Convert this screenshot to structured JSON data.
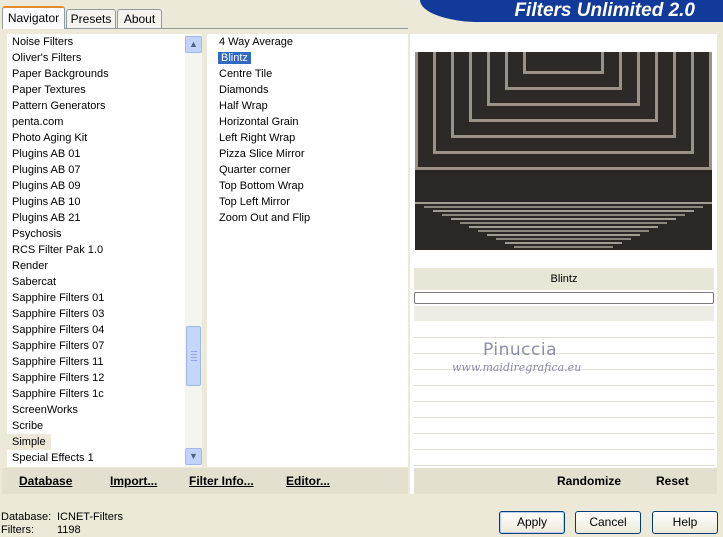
{
  "app": {
    "title": "Filters Unlimited 2.0"
  },
  "tabs": [
    {
      "label": "Navigator",
      "active": true
    },
    {
      "label": "Presets",
      "active": false
    },
    {
      "label": "About",
      "active": false
    }
  ],
  "categories": [
    "Noise Filters",
    "Oliver's Filters",
    "Paper Backgrounds",
    "Paper Textures",
    "Pattern Generators",
    "penta.com",
    "Photo Aging Kit",
    "Plugins AB 01",
    "Plugins AB 07",
    "Plugins AB 09",
    "Plugins AB 10",
    "Plugins AB 21",
    "Psychosis",
    "RCS Filter Pak 1.0",
    "Render",
    "Sabercat",
    "Sapphire Filters 01",
    "Sapphire Filters 03",
    "Sapphire Filters 04",
    "Sapphire Filters 07",
    "Sapphire Filters 11",
    "Sapphire Filters 12",
    "Sapphire Filters 1c",
    "ScreenWorks",
    "Scribe",
    "Simple",
    "Special Effects 1"
  ],
  "selected_category": "Simple",
  "filters": [
    "4 Way Average",
    "Blintz",
    "Centre Tile",
    "Diamonds",
    "Half Wrap",
    "Horizontal Grain",
    "Left Right Wrap",
    "Pizza Slice Mirror",
    "Quarter corner",
    "Top Bottom Wrap",
    "Top Left Mirror",
    "Zoom Out and Flip"
  ],
  "selected_filter": "Blintz",
  "navbar": {
    "database": "Database",
    "import": "Import...",
    "filter_info": "Filter Info...",
    "editor": "Editor..."
  },
  "preview": {
    "filter_name": "Blintz",
    "watermark_name": "Pinuccia",
    "watermark_url": "www.maidiregrafica.eu"
  },
  "actions": {
    "randomize": "Randomize",
    "reset": "Reset"
  },
  "status": {
    "database_label": "Database:",
    "database_value": "ICNET-Filters",
    "filters_label": "Filters:",
    "filters_value": "1198"
  },
  "buttons": {
    "apply": "Apply",
    "cancel": "Cancel",
    "help": "Help"
  },
  "colors": {
    "banner": "#123a9a",
    "selection": "#316ac5",
    "tab_accent": "#e68b2c"
  },
  "icons": {
    "scroll_up": "chevron-up-icon",
    "scroll_down": "chevron-down-icon"
  }
}
